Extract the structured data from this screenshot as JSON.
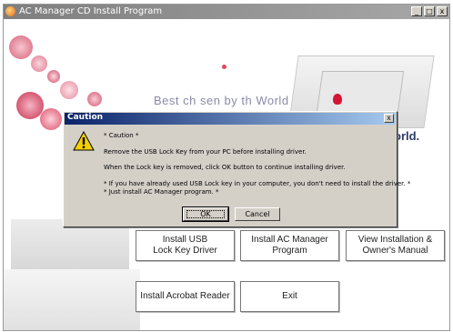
{
  "window": {
    "title": "AC Manager CD Install Program",
    "controls": [
      "_",
      "□",
      "x"
    ]
  },
  "background": {
    "tagline": "Best ch  sen by th  World",
    "world_text": "orld."
  },
  "buttons": {
    "install_usb": "Install USB\nLock Key Driver",
    "install_ac": "Install AC Manager\nProgram",
    "view_manual": "View Installation &\nOwner's Manual",
    "install_acrobat": "Install Acrobat Reader",
    "exit": "Exit"
  },
  "dialog": {
    "title": "Caution",
    "close": "x",
    "line1": "* Caution *",
    "line2": "Remove the USB Lock Key from your PC before installing driver.",
    "line3": "When the Lock key is removed, click OK button to continue installing driver.",
    "line4": "* If you have already used USB Lock key in your computer, you don't need to install the driver. *",
    "line5": "* Just install AC Manager program. *",
    "ok": "OK",
    "cancel": "Cancel"
  },
  "colors": {
    "titlebar": "#8a8a8a",
    "dialog_title": "#0a246a",
    "accent_red": "#d41535"
  },
  "icons": {
    "app": "ac-manager-icon",
    "warning": "warning-icon"
  }
}
